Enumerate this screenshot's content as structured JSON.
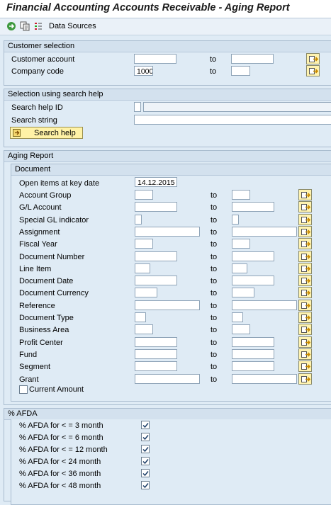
{
  "title": "Financial Accounting Accounts Receivable - Aging Report",
  "toolbar": {
    "data_sources_label": "Data Sources"
  },
  "to_label": "to",
  "customer_selection": {
    "title": "Customer selection",
    "customer_account_label": "Customer account",
    "company_code_label": "Company code",
    "company_code_value": "1000"
  },
  "search_help": {
    "title": "Selection using search help",
    "search_help_id_label": "Search help ID",
    "search_string_label": "Search string",
    "button_label": "Search help"
  },
  "aging_report": {
    "title": "Aging Report",
    "document_title": "Document",
    "open_items_label": "Open items at key date",
    "open_items_value": "14.12.2015",
    "fields": [
      "Account Group",
      "G/L Account",
      "Special GL indicator",
      "Assignment",
      "Fiscal Year",
      "Document Number",
      "Line Item",
      "Document Date",
      "Document Currency",
      "Reference",
      "Document Type",
      "Business Area",
      "Profit Center",
      "Fund",
      "Segment",
      "Grant"
    ],
    "current_amount_label": "Current Amount",
    "current_amount_checked": false
  },
  "afda": {
    "title": "% AFDA",
    "options": [
      {
        "label": "% AFDA for < = 3 month",
        "checked": true
      },
      {
        "label": "% AFDA for < = 6 month",
        "checked": true
      },
      {
        "label": "% AFDA for < = 12 month",
        "checked": true
      },
      {
        "label": "% AFDA for < 24 month",
        "checked": true
      },
      {
        "label": "% AFDA for < 36 month",
        "checked": true
      },
      {
        "label": "% AFDA for < 48 month",
        "checked": true
      }
    ]
  },
  "colors": {
    "background": "#dfebf5",
    "group_header": "#d3e1ee",
    "button_yellow": "#fff2a6",
    "arrow_yellow": "#e8b400"
  },
  "icons": [
    "execute-icon",
    "variant-icon",
    "selection-options-icon",
    "multiple-selection-icon",
    "checkmark-icon"
  ]
}
